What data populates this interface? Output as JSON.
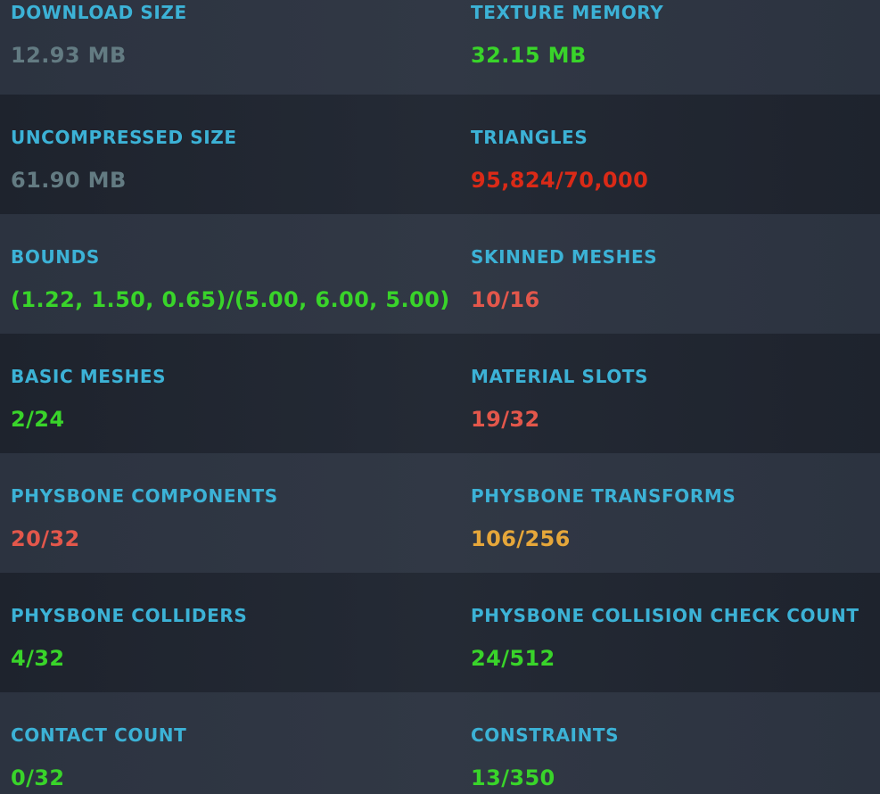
{
  "colors": {
    "label": "#3cb2d6",
    "neutral": "#637b82",
    "good": "#39d42a",
    "medium": "#e3574b",
    "poor": "#e6a73a",
    "very_poor": "#da2a17"
  },
  "stats": [
    {
      "left": {
        "label": "DOWNLOAD SIZE",
        "value": "12.93 MB",
        "status": "neutral"
      },
      "right": {
        "label": "TEXTURE MEMORY",
        "value": "32.15 MB",
        "status": "good"
      }
    },
    {
      "left": {
        "label": "UNCOMPRESSED SIZE",
        "value": "61.90 MB",
        "status": "neutral"
      },
      "right": {
        "label": "TRIANGLES",
        "value": "95,824/70,000",
        "status": "very_poor"
      }
    },
    {
      "left": {
        "label": "BOUNDS",
        "value": "(1.22, 1.50, 0.65)/(5.00, 6.00, 5.00)",
        "status": "good"
      },
      "right": {
        "label": "SKINNED MESHES",
        "value": "10/16",
        "status": "medium"
      }
    },
    {
      "left": {
        "label": "BASIC MESHES",
        "value": "2/24",
        "status": "good"
      },
      "right": {
        "label": "MATERIAL SLOTS",
        "value": "19/32",
        "status": "medium"
      }
    },
    {
      "left": {
        "label": "PHYSBONE COMPONENTS",
        "value": "20/32",
        "status": "medium"
      },
      "right": {
        "label": "PHYSBONE TRANSFORMS",
        "value": "106/256",
        "status": "poor"
      }
    },
    {
      "left": {
        "label": "PHYSBONE COLLIDERS",
        "value": "4/32",
        "status": "good"
      },
      "right": {
        "label": "PHYSBONE COLLISION CHECK COUNT",
        "value": "24/512",
        "status": "good"
      }
    },
    {
      "left": {
        "label": "CONTACT COUNT",
        "value": "0/32",
        "status": "good"
      },
      "right": {
        "label": "CONSTRAINTS",
        "value": "13/350",
        "status": "good"
      }
    }
  ]
}
